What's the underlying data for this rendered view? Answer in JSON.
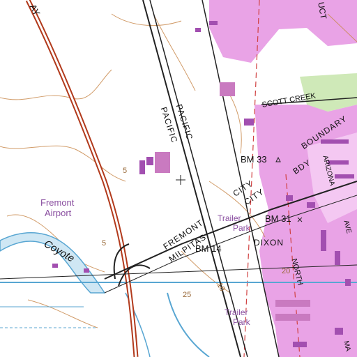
{
  "map": {
    "colors": {
      "urban": "#e9a3e6",
      "urban_light": "#f4c8f2",
      "building": "#a24fb0",
      "highway": "#b23a1c",
      "water": "#58a6d2",
      "water_fill": "#cfe7f4",
      "contour": "#c98a4e",
      "grid": "#d04040",
      "green": "#cfe9b8",
      "rail": "#222222"
    },
    "labels": {
      "way_top": "AY",
      "uct_top": "UCT",
      "scott_creek": "SCOTT  CREEK",
      "pacific_1": "PACIFIC",
      "pacific_2": "PACIFIC",
      "bm33": "BM 33",
      "boundary": "BOUNDARY",
      "bdy": "BDY",
      "city_1": "CITY",
      "city_2": "CITY",
      "fremont": "FREMONT",
      "milpitas": "MILPITAS",
      "fremont_airport_1": "Fremont",
      "fremont_airport_2": "Airport",
      "trailer_park_1a": "Trailer",
      "trailer_park_1b": "Park",
      "bm31": "BM 31",
      "bm14": "BM 14",
      "dixon": "DIXON",
      "coyote": "Coyote",
      "north": "NORTH",
      "arizona": "ARIZONA",
      "trailer_park_2a": "Trailer",
      "trailer_park_2b": "Park",
      "contour_5a": "5",
      "contour_5b": "5",
      "contour_10": "10",
      "contour_20": "20",
      "contour_25": "25",
      "ave": "AVE",
      "ma": "MA"
    }
  }
}
